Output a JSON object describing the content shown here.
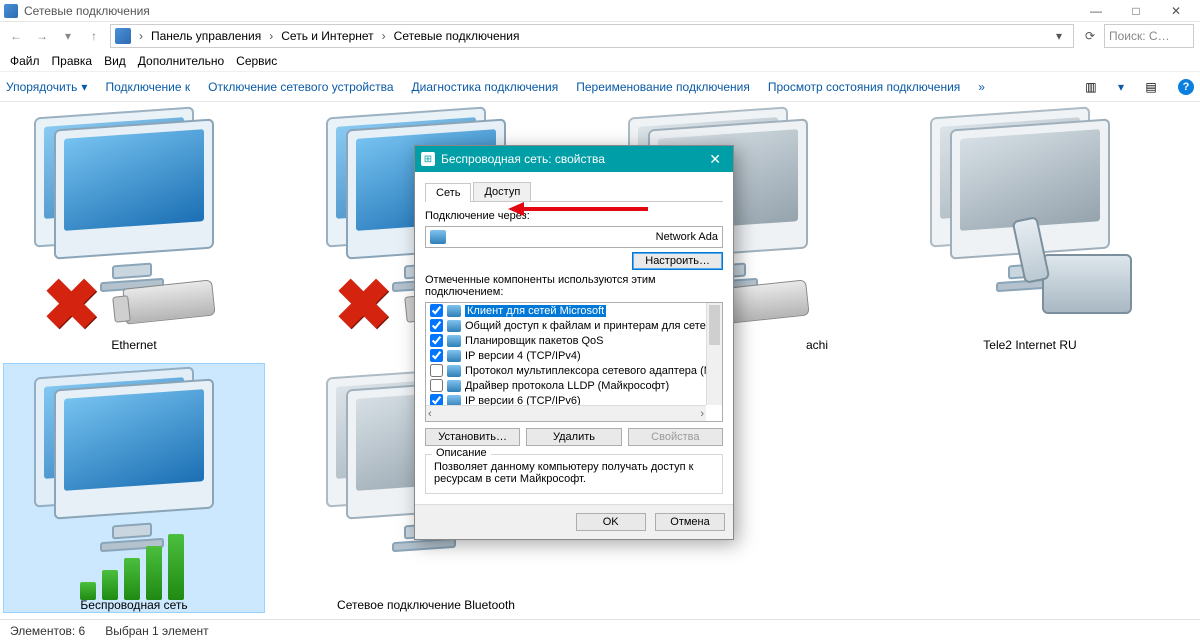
{
  "window": {
    "title": "Сетевые подключения",
    "search_placeholder": "Поиск: С…"
  },
  "breadcrumb": [
    "Панель управления",
    "Сеть и Интернет",
    "Сетевые подключения"
  ],
  "menubar": [
    "Файл",
    "Правка",
    "Вид",
    "Дополнительно",
    "Сервис"
  ],
  "toolbar": {
    "organize": "Упорядочить",
    "connect": "Подключение к",
    "disable": "Отключение сетевого устройства",
    "diagnose": "Диагностика подключения",
    "rename": "Переименование подключения",
    "status": "Просмотр состояния подключения",
    "more": "»"
  },
  "connections": {
    "ethernet": "Ethernet",
    "hamachi": "achi",
    "tele2": "Tele2 Internet RU",
    "wireless": "Беспроводная сеть",
    "bluetooth": "Сетевое подключение Bluetooth"
  },
  "statusbar": {
    "count": "Элементов: 6",
    "selected": "Выбран 1 элемент"
  },
  "dialog": {
    "title": "Беспроводная сеть: свойства",
    "tab_network": "Сеть",
    "tab_sharing": "Доступ",
    "connect_using": "Подключение через:",
    "adapter_suffix": "Network Ada",
    "configure": "Настроить…",
    "components_label": "Отмеченные компоненты используются этим подключением:",
    "components": [
      {
        "checked": true,
        "label": "Клиент для сетей Microsoft",
        "selected": true
      },
      {
        "checked": true,
        "label": "Общий доступ к файлам и принтерам для сетей Mi"
      },
      {
        "checked": true,
        "label": "Планировщик пакетов QoS"
      },
      {
        "checked": true,
        "label": "IP версии 4 (TCP/IPv4)"
      },
      {
        "checked": false,
        "label": "Протокол мультиплексора сетевого адаптера (Ma"
      },
      {
        "checked": false,
        "label": "Драйвер протокола LLDP (Майкрософт)"
      },
      {
        "checked": true,
        "label": "IP версии 6 (TCP/IPv6)"
      }
    ],
    "install": "Установить…",
    "uninstall": "Удалить",
    "properties": "Свойства",
    "description_legend": "Описание",
    "description_text": "Позволяет данному компьютеру получать доступ к ресурсам в сети Майкрософт.",
    "ok": "OK",
    "cancel": "Отмена"
  }
}
